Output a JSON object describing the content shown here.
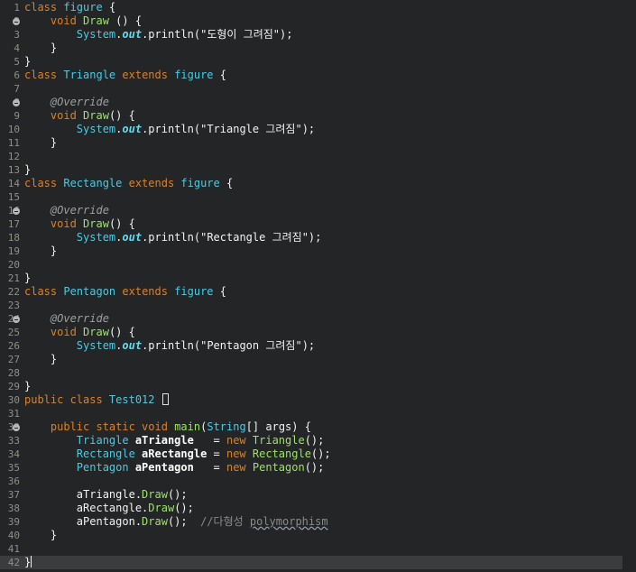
{
  "editor": {
    "lines": [
      {
        "n": "1",
        "fold": false,
        "tokens": [
          [
            "kwo",
            "class "
          ],
          [
            "cyan",
            "figure"
          ],
          [
            "white",
            " {"
          ]
        ]
      },
      {
        "n": "2",
        "fold": true,
        "tokens": [
          [
            "white",
            "    "
          ],
          [
            "kwo",
            "void "
          ],
          [
            "green",
            "Draw"
          ],
          [
            "white",
            " () {"
          ]
        ]
      },
      {
        "n": "3",
        "fold": false,
        "tokens": [
          [
            "white",
            "        "
          ],
          [
            "cyan",
            "System"
          ],
          [
            "white",
            "."
          ],
          [
            "fld",
            "out"
          ],
          [
            "white",
            ".println(\""
          ],
          [
            "white",
            "도형이 그려짐"
          ],
          [
            "white",
            "\");"
          ]
        ]
      },
      {
        "n": "4",
        "fold": false,
        "tokens": [
          [
            "white",
            "    }"
          ]
        ]
      },
      {
        "n": "5",
        "fold": false,
        "tokens": [
          [
            "white",
            "}"
          ]
        ]
      },
      {
        "n": "6",
        "fold": false,
        "tokens": [
          [
            "kwo",
            "class "
          ],
          [
            "cyan",
            "Triangle "
          ],
          [
            "kwo",
            "extends "
          ],
          [
            "cyan",
            "figure"
          ],
          [
            "white",
            " {"
          ]
        ]
      },
      {
        "n": "7",
        "fold": false,
        "tokens": [
          [
            "white",
            ""
          ]
        ]
      },
      {
        "n": "8",
        "fold": true,
        "tokens": [
          [
            "white",
            "    "
          ],
          [
            "ann",
            "@Override"
          ]
        ]
      },
      {
        "n": "9",
        "fold": false,
        "tokens": [
          [
            "white",
            "    "
          ],
          [
            "kwo",
            "void "
          ],
          [
            "green",
            "Draw"
          ],
          [
            "white",
            "() {"
          ]
        ]
      },
      {
        "n": "10",
        "fold": false,
        "tokens": [
          [
            "white",
            "        "
          ],
          [
            "cyan",
            "System"
          ],
          [
            "white",
            "."
          ],
          [
            "fld",
            "out"
          ],
          [
            "white",
            ".println(\"Triangle 그려짐\");"
          ]
        ]
      },
      {
        "n": "11",
        "fold": false,
        "tokens": [
          [
            "white",
            "    }"
          ]
        ]
      },
      {
        "n": "12",
        "fold": false,
        "tokens": [
          [
            "white",
            ""
          ]
        ]
      },
      {
        "n": "13",
        "fold": false,
        "tokens": [
          [
            "white",
            "}"
          ]
        ]
      },
      {
        "n": "14",
        "fold": false,
        "tokens": [
          [
            "kwo",
            "class "
          ],
          [
            "cyan",
            "Rectangle "
          ],
          [
            "kwo",
            "extends "
          ],
          [
            "cyan",
            "figure"
          ],
          [
            "white",
            " {"
          ]
        ]
      },
      {
        "n": "15",
        "fold": false,
        "tokens": [
          [
            "white",
            ""
          ]
        ]
      },
      {
        "n": "16",
        "fold": true,
        "tokens": [
          [
            "white",
            "    "
          ],
          [
            "ann",
            "@Override"
          ]
        ]
      },
      {
        "n": "17",
        "fold": false,
        "tokens": [
          [
            "white",
            "    "
          ],
          [
            "kwo",
            "void "
          ],
          [
            "green",
            "Draw"
          ],
          [
            "white",
            "() {"
          ]
        ]
      },
      {
        "n": "18",
        "fold": false,
        "tokens": [
          [
            "white",
            "        "
          ],
          [
            "cyan",
            "System"
          ],
          [
            "white",
            "."
          ],
          [
            "fld",
            "out"
          ],
          [
            "white",
            ".println(\"Rectangle 그려짐\");"
          ]
        ]
      },
      {
        "n": "19",
        "fold": false,
        "tokens": [
          [
            "white",
            "    }"
          ]
        ]
      },
      {
        "n": "20",
        "fold": false,
        "tokens": [
          [
            "white",
            ""
          ]
        ]
      },
      {
        "n": "21",
        "fold": false,
        "tokens": [
          [
            "white",
            "}"
          ]
        ]
      },
      {
        "n": "22",
        "fold": false,
        "tokens": [
          [
            "kwo",
            "class "
          ],
          [
            "cyan",
            "Pentagon "
          ],
          [
            "kwo",
            "extends "
          ],
          [
            "cyan",
            "figure"
          ],
          [
            "white",
            " {"
          ]
        ]
      },
      {
        "n": "23",
        "fold": false,
        "tokens": [
          [
            "white",
            ""
          ]
        ]
      },
      {
        "n": "24",
        "fold": true,
        "tokens": [
          [
            "white",
            "    "
          ],
          [
            "ann",
            "@Override"
          ]
        ]
      },
      {
        "n": "25",
        "fold": false,
        "tokens": [
          [
            "white",
            "    "
          ],
          [
            "kwo",
            "void "
          ],
          [
            "green",
            "Draw"
          ],
          [
            "white",
            "() {"
          ]
        ]
      },
      {
        "n": "26",
        "fold": false,
        "tokens": [
          [
            "white",
            "        "
          ],
          [
            "cyan",
            "System"
          ],
          [
            "white",
            "."
          ],
          [
            "fld",
            "out"
          ],
          [
            "white",
            ".println(\"Pentagon 그려짐\");"
          ]
        ]
      },
      {
        "n": "27",
        "fold": false,
        "tokens": [
          [
            "white",
            "    }"
          ]
        ]
      },
      {
        "n": "28",
        "fold": false,
        "tokens": [
          [
            "white",
            ""
          ]
        ]
      },
      {
        "n": "29",
        "fold": false,
        "tokens": [
          [
            "white",
            "}"
          ]
        ]
      },
      {
        "n": "30",
        "fold": false,
        "tokens": [
          [
            "kwo",
            "public class "
          ],
          [
            "cyan",
            "Test012 "
          ],
          [
            "box",
            ""
          ]
        ]
      },
      {
        "n": "31",
        "fold": false,
        "tokens": [
          [
            "white",
            ""
          ]
        ]
      },
      {
        "n": "32",
        "fold": true,
        "tokens": [
          [
            "white",
            "    "
          ],
          [
            "kwo",
            "public static void "
          ],
          [
            "green",
            "main"
          ],
          [
            "white",
            "("
          ],
          [
            "cyan",
            "String"
          ],
          [
            "white",
            "[] "
          ],
          [
            "white",
            "args) {"
          ]
        ]
      },
      {
        "n": "33",
        "fold": false,
        "tokens": [
          [
            "white",
            "        "
          ],
          [
            "cyan",
            "Triangle "
          ],
          [
            "varb",
            "aTriangle"
          ],
          [
            "white",
            "   = "
          ],
          [
            "kwo",
            "new "
          ],
          [
            "green",
            "Triangle"
          ],
          [
            "white",
            "();"
          ]
        ]
      },
      {
        "n": "34",
        "fold": false,
        "tokens": [
          [
            "white",
            "        "
          ],
          [
            "cyan",
            "Rectangle "
          ],
          [
            "varb",
            "aRectangle"
          ],
          [
            "white",
            " = "
          ],
          [
            "kwo",
            "new "
          ],
          [
            "green",
            "Rectangle"
          ],
          [
            "white",
            "();"
          ]
        ]
      },
      {
        "n": "35",
        "fold": false,
        "tokens": [
          [
            "white",
            "        "
          ],
          [
            "cyan",
            "Pentagon "
          ],
          [
            "varb",
            "aPentagon"
          ],
          [
            "white",
            "   = "
          ],
          [
            "kwo",
            "new "
          ],
          [
            "green",
            "Pentagon"
          ],
          [
            "white",
            "();"
          ]
        ]
      },
      {
        "n": "36",
        "fold": false,
        "tokens": [
          [
            "white",
            ""
          ]
        ]
      },
      {
        "n": "37",
        "fold": false,
        "tokens": [
          [
            "white",
            "        aTriangle."
          ],
          [
            "green",
            "Draw"
          ],
          [
            "white",
            "();"
          ]
        ]
      },
      {
        "n": "38",
        "fold": false,
        "tokens": [
          [
            "white",
            "        aRectangle."
          ],
          [
            "green",
            "Draw"
          ],
          [
            "white",
            "();"
          ]
        ]
      },
      {
        "n": "39",
        "fold": false,
        "tokens": [
          [
            "white",
            "        aPentagon."
          ],
          [
            "green",
            "Draw"
          ],
          [
            "white",
            "();  "
          ],
          [
            "com",
            "//다형성 "
          ],
          [
            "comsq",
            "polymorphism"
          ]
        ]
      },
      {
        "n": "40",
        "fold": false,
        "tokens": [
          [
            "white",
            "    }"
          ]
        ]
      },
      {
        "n": "41",
        "fold": false,
        "tokens": [
          [
            "white",
            ""
          ]
        ]
      },
      {
        "n": "42",
        "fold": false,
        "current": true,
        "tokens": [
          [
            "white",
            "}"
          ],
          [
            "caret",
            ""
          ]
        ]
      }
    ]
  },
  "colors": {
    "background": "#232526",
    "current_line": "#3a3c3e",
    "keyword": "#d9822b",
    "type": "#4ec9e0",
    "method": "#9ee26b",
    "annotation": "#a0a0a0",
    "comment": "#8a8a8a"
  }
}
